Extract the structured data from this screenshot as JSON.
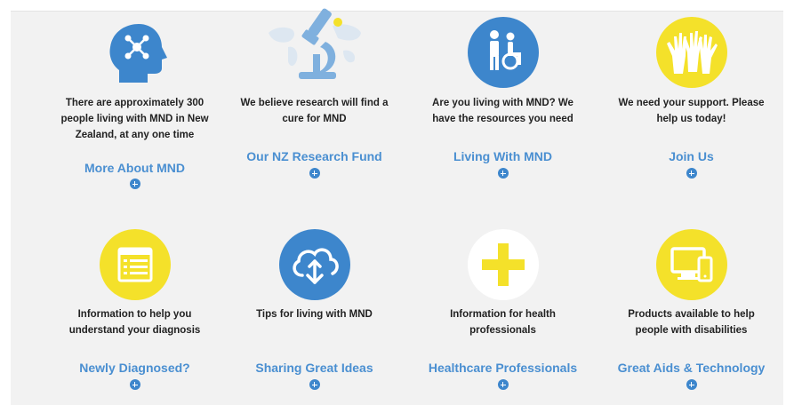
{
  "colors": {
    "blue": "#3d86cc",
    "yellow": "#f4e12a",
    "link": "#4a8fd1"
  },
  "cards": [
    {
      "icon": "head-network-icon",
      "desc": [
        "There are approximately 300",
        "people living with MND in New",
        "Zealand, at any one time"
      ],
      "link": "More About MND"
    },
    {
      "icon": "microscope-icon",
      "desc": [
        "We believe research will find a",
        "cure for MND"
      ],
      "link": "Our NZ Research Fund"
    },
    {
      "icon": "wheelchair-icon",
      "desc": [
        "Are you living with MND? We",
        "have the resources you need"
      ],
      "link": "Living With MND"
    },
    {
      "icon": "raised-hands-icon",
      "desc": [
        "We need your support. Please",
        "help us today!"
      ],
      "link": "Join Us"
    },
    {
      "icon": "document-icon",
      "desc": [
        "Information to help you",
        "understand your diagnosis"
      ],
      "link": "Newly Diagnosed?"
    },
    {
      "icon": "cloud-upload-icon",
      "desc": [
        "Tips for living with MND"
      ],
      "link": "Sharing Great Ideas"
    },
    {
      "icon": "medical-cross-icon",
      "desc": [
        "Information for health",
        "professionals"
      ],
      "link": "Healthcare Professionals"
    },
    {
      "icon": "devices-icon",
      "desc": [
        "Products available to help",
        "people with disabilities"
      ],
      "link": "Great Aids & Technology"
    }
  ]
}
